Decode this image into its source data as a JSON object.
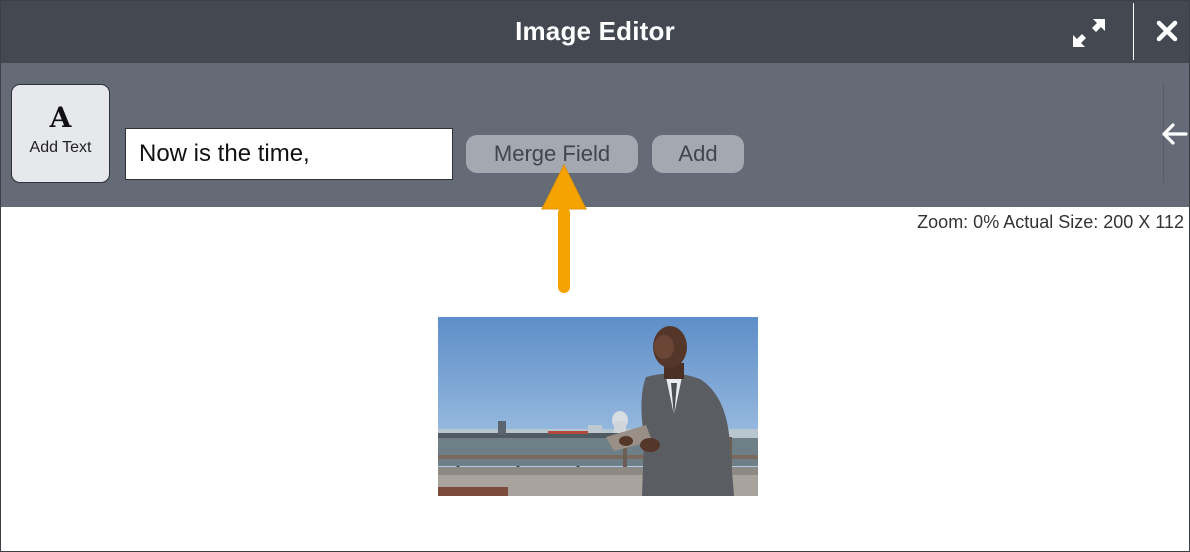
{
  "window": {
    "title": "Image Editor",
    "expand_icon": "expand-arrows-icon",
    "close_icon": "close-x-icon"
  },
  "toolbar": {
    "add_text": {
      "glyph": "A",
      "label": "Add Text"
    },
    "text_input": {
      "value": "Now is the time,"
    },
    "merge_field_label": "Merge Field",
    "add_label": "Add",
    "collapse_icon": "arrow-left-icon"
  },
  "canvas": {
    "zoom_info": "Zoom: 0% Actual Size: 200 X 112",
    "annotation_arrow_color": "#f5a300"
  },
  "colors": {
    "titlebar_bg": "#434851",
    "toolbar_bg": "#656b76",
    "button_bg": "#a3a8b1"
  }
}
